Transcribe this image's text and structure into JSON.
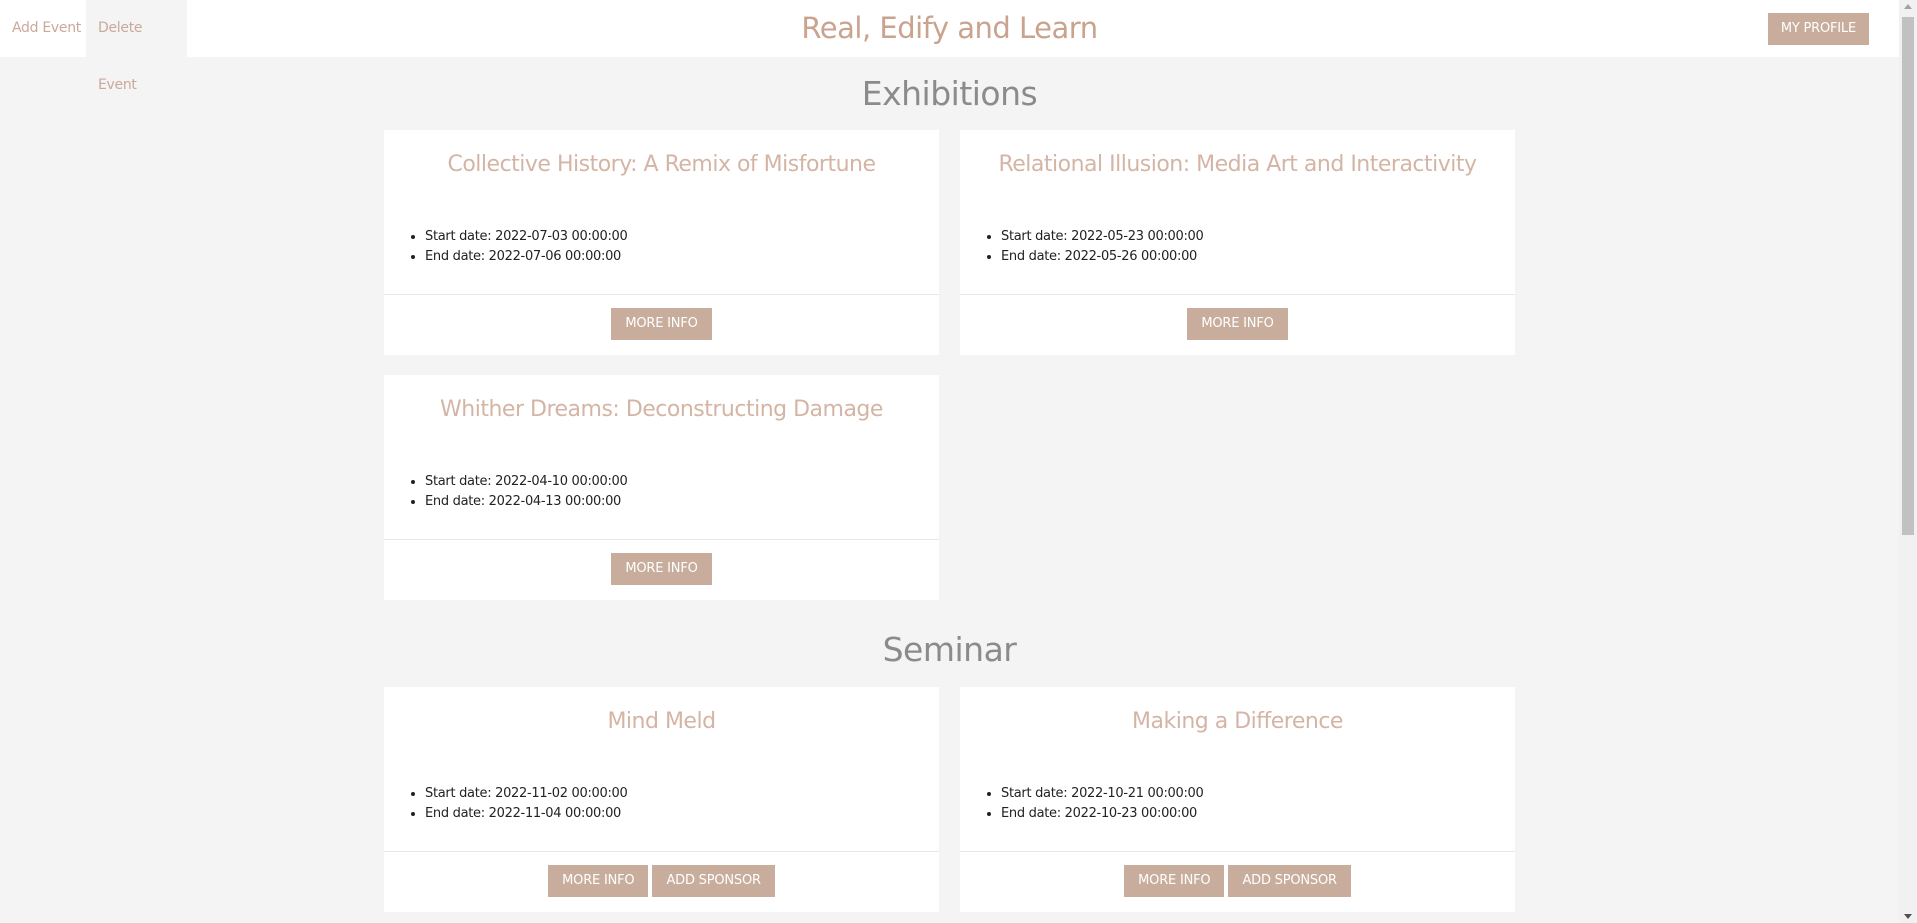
{
  "nav": {
    "add_event": "Add Event",
    "delete_event": "Delete Event"
  },
  "site_title": "Real, Edify and Learn",
  "profile_button": "MY PROFILE",
  "sections": [
    {
      "title": "Exhibitions",
      "events": [
        {
          "title": "Collective History: A Remix of Misfortune",
          "start": "Start date: 2022-07-03 00:00:00",
          "end": "End date: 2022-07-06 00:00:00",
          "more_info": "MORE INFO"
        },
        {
          "title": "Relational Illusion: Media Art and Interactivity",
          "start": "Start date: 2022-05-23 00:00:00",
          "end": "End date: 2022-05-26 00:00:00",
          "more_info": "MORE INFO"
        },
        {
          "title": "Whither Dreams: Deconstructing Damage",
          "start": "Start date: 2022-04-10 00:00:00",
          "end": "End date: 2022-04-13 00:00:00",
          "more_info": "MORE INFO"
        }
      ]
    },
    {
      "title": "Seminar",
      "events": [
        {
          "title": "Mind Meld",
          "start": "Start date: 2022-11-02 00:00:00",
          "end": "End date: 2022-11-04 00:00:00",
          "more_info": "MORE INFO",
          "add_sponsor": "ADD SPONSOR"
        },
        {
          "title": "Making a Difference",
          "start": "Start date: 2022-10-21 00:00:00",
          "end": "End date: 2022-10-23 00:00:00",
          "more_info": "MORE INFO",
          "add_sponsor": "ADD SPONSOR"
        }
      ]
    }
  ],
  "colors": {
    "accent": "#c8ad9c",
    "title_text": "#c9a38e",
    "card_title_text": "#d4b5a5",
    "section_title_text": "#8b8b8b",
    "page_background": "#f4f4f4"
  }
}
